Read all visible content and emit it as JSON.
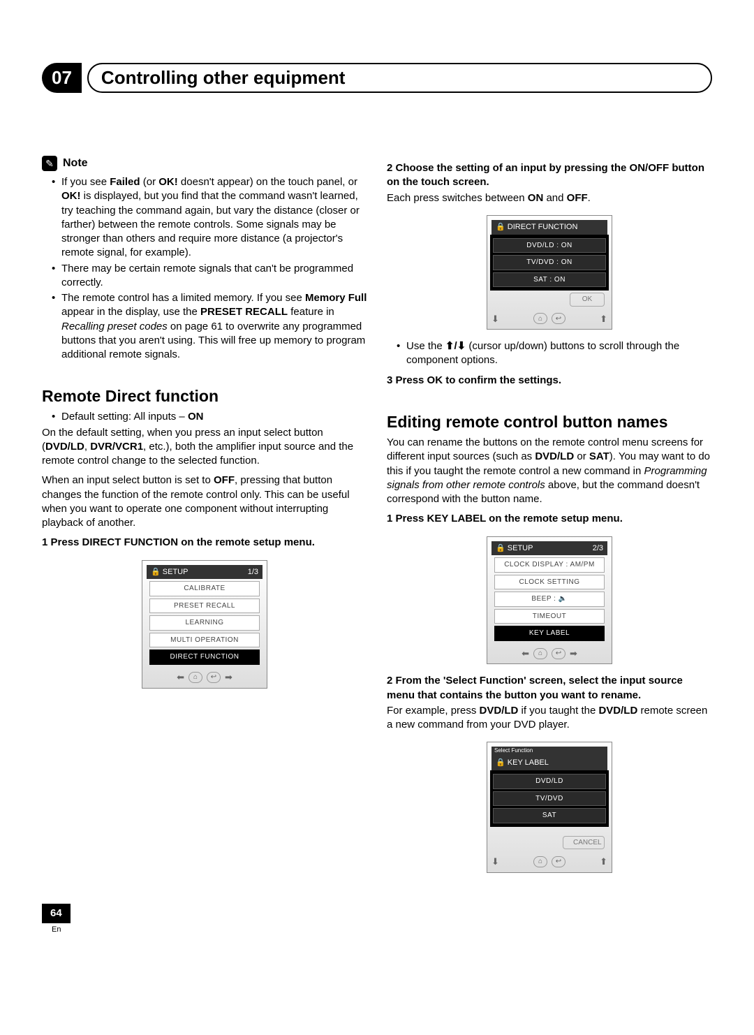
{
  "chapter": {
    "number": "07",
    "title": "Controlling other equipment"
  },
  "note": {
    "label": "Note",
    "b1a": "If you see ",
    "b1b": "Failed",
    "b1c": " (or ",
    "b1d": "OK!",
    "b1e": " doesn't appear) on the touch panel, or ",
    "b1f": "OK!",
    "b1g": " is displayed, but you find that the command wasn't learned, try teaching the command again, but vary the distance (closer or farther) between the remote controls. Some signals may be stronger than others and require more distance (a projector's remote signal, for example).",
    "b2": "There may be certain remote signals that can't be programmed correctly.",
    "b3a": "The remote control has a limited memory. If you see ",
    "b3b": "Memory Full",
    "b3c": " appear in the display, use the ",
    "b3d": "PRESET RECALL",
    "b3e": " feature in ",
    "b3f": "Recalling preset codes",
    "b3g": " on page 61 to overwrite any programmed buttons that you aren't using. This will free up memory to program additional remote signals."
  },
  "rdf": {
    "heading": "Remote Direct function",
    "default_a": "Default setting: All inputs – ",
    "default_b": "ON",
    "p1a": "On the default setting, when you press an input select button (",
    "p1b": "DVD/LD",
    "p1c": ", ",
    "p1d": "DVR/VCR1",
    "p1e": ", etc.), both the amplifier input source and the remote control change to the selected function.",
    "p2a": "When an input select button is set to ",
    "p2b": "OFF",
    "p2c": ", pressing that button changes the function of the remote control only. This can be useful when you want to operate one component without interrupting playback of another.",
    "step1": "1    Press DIRECT FUNCTION on the remote setup menu."
  },
  "screen1": {
    "title_left": "SETUP",
    "title_right": "1/3",
    "r1": "CALIBRATE",
    "r2": "PRESET RECALL",
    "r3": "LEARNING",
    "r4": "MULTI OPERATION",
    "r5": "DIRECT FUNCTION"
  },
  "right": {
    "step2": "2    Choose the setting of an input by pressing the ON/OFF button on the touch screen.",
    "p_each_a": "Each press switches between ",
    "p_each_b": "ON",
    "p_each_c": " and ",
    "p_each_d": "OFF",
    "p_each_e": ".",
    "use_a": "Use the ",
    "use_b": " (cursor up/down) buttons to scroll through the component options.",
    "step3": "3    Press OK to confirm the settings."
  },
  "screen2": {
    "title": "DIRECT FUNCTION",
    "r1": "DVD/LD : ON",
    "r2": "TV/DVD : ON",
    "r3": "SAT : ON",
    "ok": "OK"
  },
  "edit": {
    "heading": "Editing remote control button names",
    "p1a": "You can rename the buttons on the remote control menu screens for different input sources (such as ",
    "p1b": "DVD/LD",
    "p1c": " or ",
    "p1d": "SAT",
    "p1e": "). You may want to do this if you taught the remote control a new command in ",
    "p1f": "Programming signals from other remote controls",
    "p1g": " above, but the command doesn't correspond with the button name.",
    "step1": "1    Press KEY LABEL on the remote setup menu.",
    "step2": "2    From the 'Select Function' screen, select the input source menu that contains the button you want to rename.",
    "p2a": "For example, press ",
    "p2b": "DVD/LD",
    "p2c": " if you taught the ",
    "p2d": "DVD/LD",
    "p2e": " remote screen a new command from your DVD player."
  },
  "screen3": {
    "title_left": "SETUP",
    "title_right": "2/3",
    "r1": "CLOCK DISPLAY : AM/PM",
    "r2": "CLOCK SETTING",
    "r3": "BEEP :",
    "r4": "TIMEOUT",
    "r5": "KEY LABEL"
  },
  "screen4": {
    "small": "Select Function",
    "title": "KEY LABEL",
    "r1": "DVD/LD",
    "r2": "TV/DVD",
    "r3": "SAT",
    "cancel": "CANCEL"
  },
  "footer": {
    "page": "64",
    "lang": "En"
  }
}
